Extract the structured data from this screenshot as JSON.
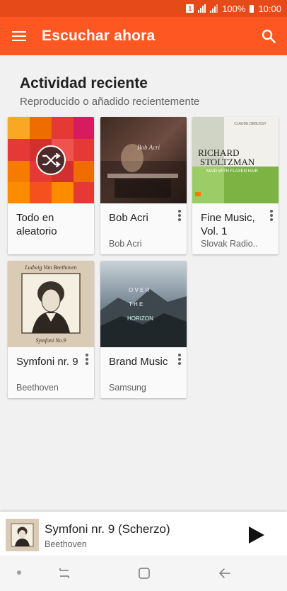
{
  "status_bar": {
    "sim_label": "1",
    "battery": "100%",
    "time": "10:00"
  },
  "app_bar": {
    "title": "Escuchar ahora",
    "menu_icon": "menu-icon",
    "search_icon": "search-icon"
  },
  "section": {
    "title": "Actividad reciente",
    "subtitle": "Reproducido o añadido recientemente"
  },
  "cards": [
    {
      "title": "Todo en aleatorio",
      "subtitle": "",
      "art": "shuffle-mosaic"
    },
    {
      "title": "Bob Acri",
      "subtitle": "Bob Acri",
      "art": "piano-photo",
      "art_text": "Bob Acri"
    },
    {
      "title": "Fine Music, Vol. 1",
      "subtitle": "Slovak Radio..",
      "art": "richard-stoltzman-cover",
      "art_text_top": "CLAUDE DEBUSSY",
      "art_text_name1": "RICHARD",
      "art_text_name2": "STOLTZMAN",
      "art_text_sub": "MAID WITH FLAXEN HAIR"
    },
    {
      "title": "Symfoni nr. 9",
      "subtitle": "Beethoven",
      "art": "beethoven-portrait",
      "art_text_top": "Ludwig Van Beethoven",
      "art_text_bottom": "Symfoni No.9"
    },
    {
      "title": "Brand Music",
      "subtitle": "Samsung",
      "art": "mountain-horizon",
      "art_text_1": "O V E R",
      "art_text_2": "T H E",
      "art_text_3": "HORIZON"
    }
  ],
  "now_playing": {
    "title": "Symfoni nr. 9 (Scherzo)",
    "artist": "Beethoven",
    "play_icon": "play-icon"
  },
  "nav_bar": {
    "recents_icon": "recents-icon",
    "home_icon": "home-icon",
    "back_icon": "back-icon"
  },
  "colors": {
    "accent": "#ff5722",
    "status_bar": "#e64a19",
    "background": "#f1f1f1"
  }
}
